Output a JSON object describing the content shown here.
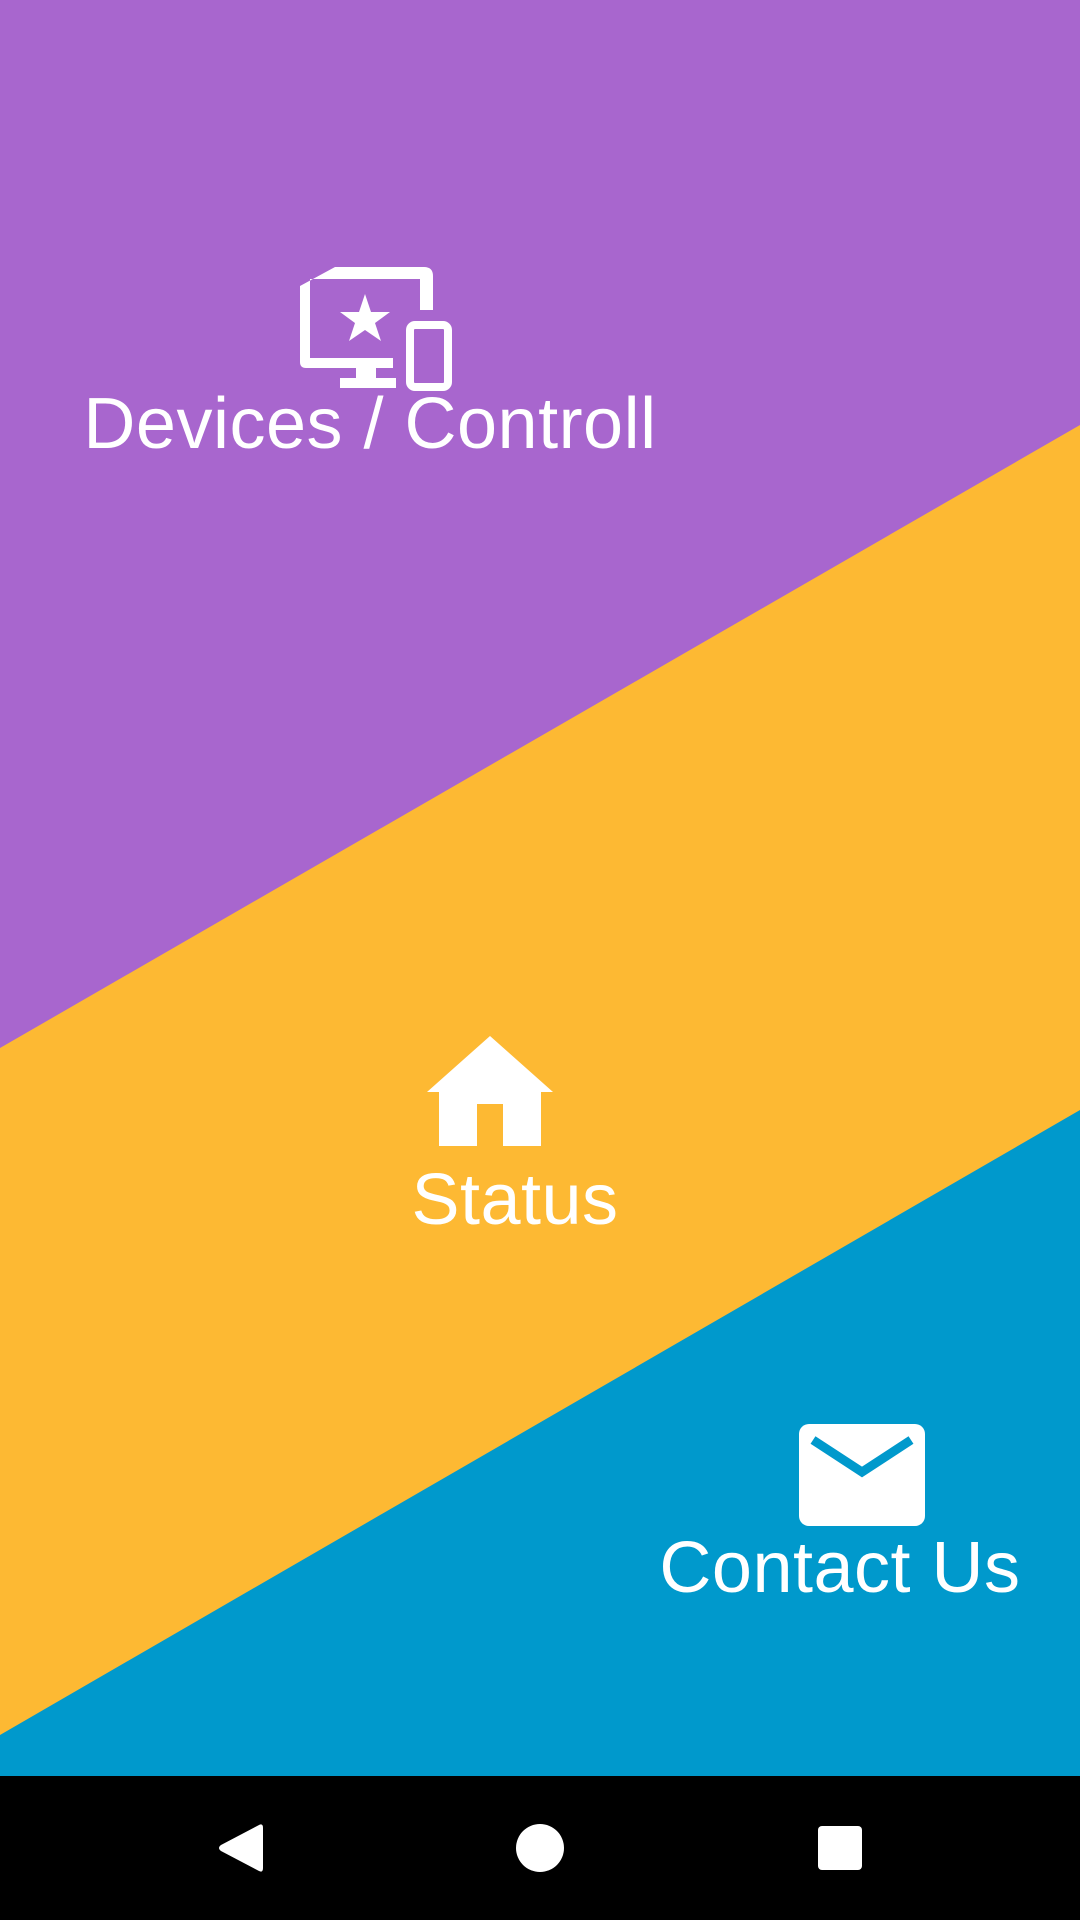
{
  "colors": {
    "purple_band": "#A866CE",
    "yellow_band": "#FDB933",
    "blue_band": "#0099CC",
    "nav_background": "#000000",
    "foreground": "#FFFFFF"
  },
  "tiles": {
    "devices": {
      "label": "Devices / Controll",
      "icon": "devices-star-icon"
    },
    "status": {
      "label": "Status",
      "icon": "home-icon"
    },
    "contact": {
      "label": "Contact Us",
      "icon": "mail-icon"
    }
  },
  "nav": {
    "back_icon": "back-triangle-icon",
    "home_icon": "home-circle-icon",
    "recents_icon": "recents-square-icon"
  }
}
